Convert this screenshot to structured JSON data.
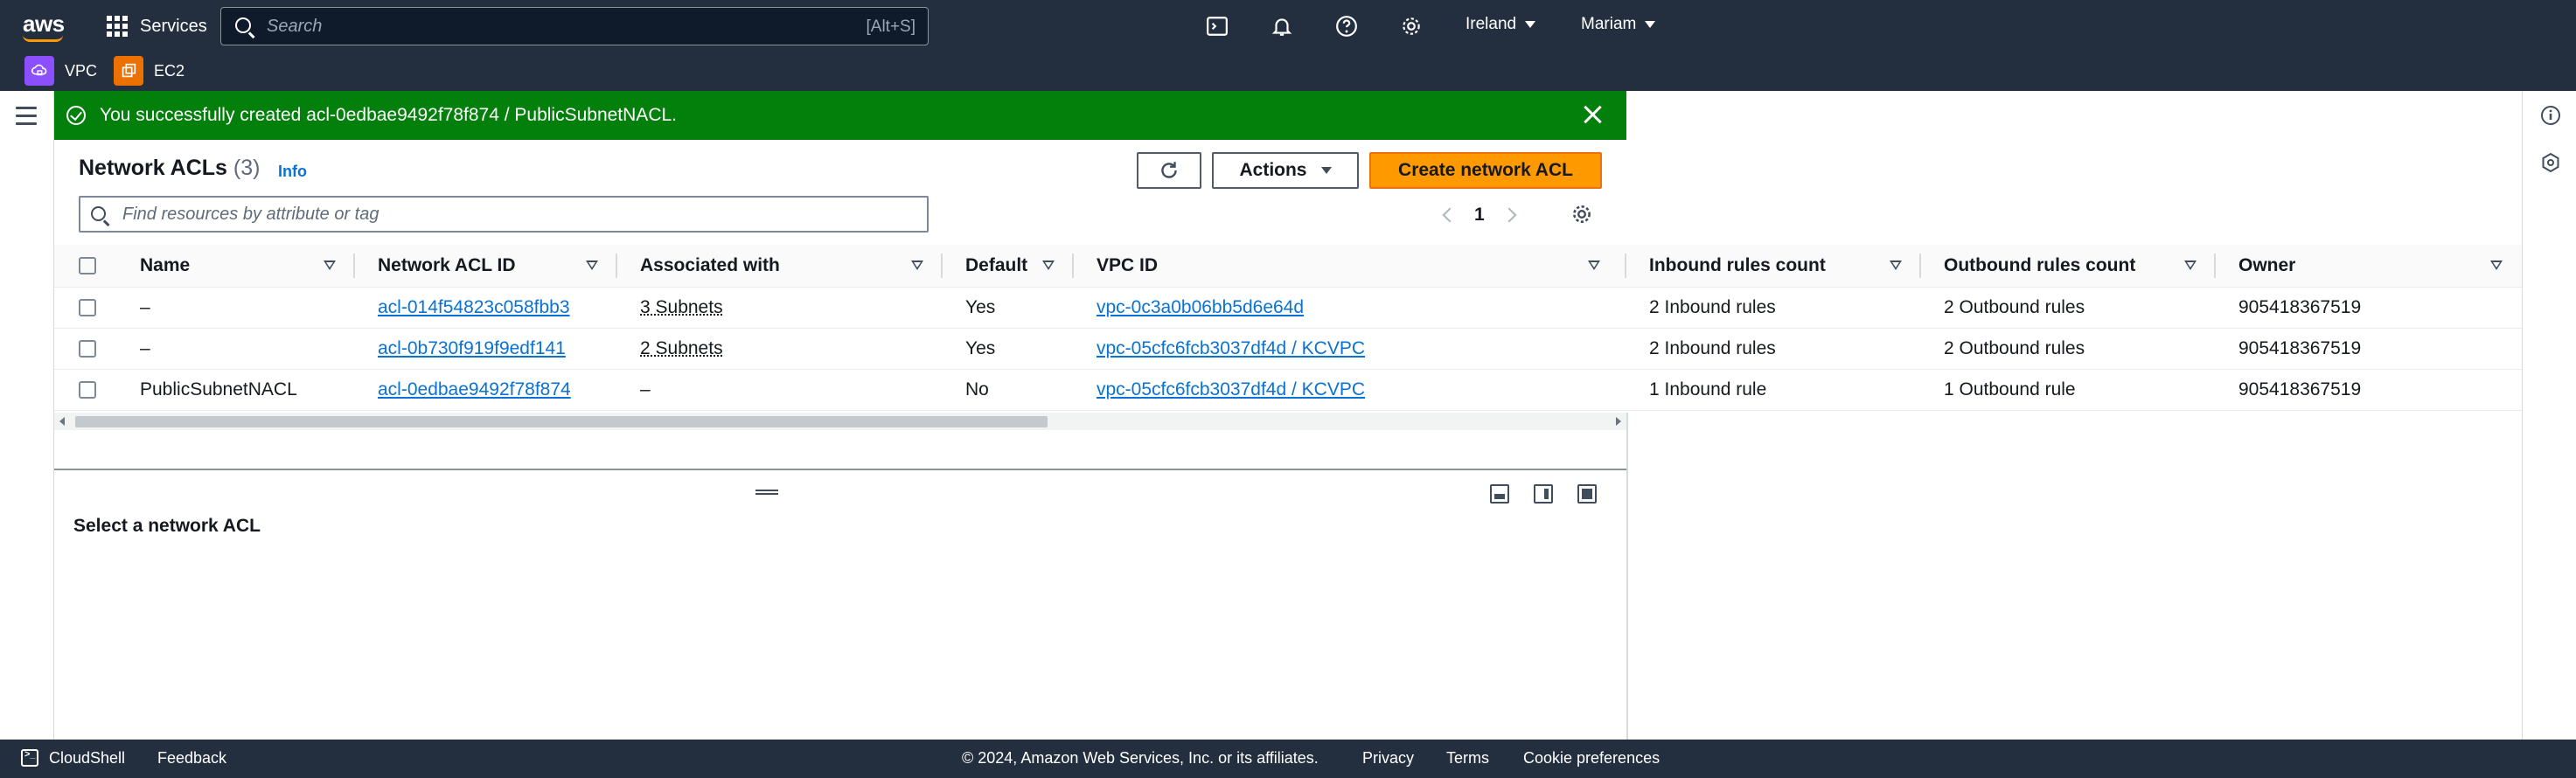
{
  "topbar": {
    "logo": "aws",
    "services_label": "Services",
    "search_placeholder": "Search",
    "search_shortcut": "[Alt+S]",
    "region": "Ireland",
    "user": "Mariam"
  },
  "favorites": [
    {
      "label": "VPC",
      "color": "#8c4fff"
    },
    {
      "label": "EC2",
      "color": "#ed7100"
    }
  ],
  "flash": {
    "message": "You successfully created acl-0edbae9492f78f874 / PublicSubnetNACL."
  },
  "header": {
    "title": "Network ACLs",
    "count": "(3)",
    "info": "Info",
    "actions_label": "Actions",
    "create_label": "Create network ACL",
    "filter_placeholder": "Find resources by attribute or tag",
    "page": "1"
  },
  "columns": [
    "Name",
    "Network ACL ID",
    "Associated with",
    "Default",
    "VPC ID",
    "Inbound rules count",
    "Outbound rules count",
    "Owner"
  ],
  "rows": [
    {
      "name": "–",
      "acl_id": "acl-014f54823c058fbb3",
      "associated": "3 Subnets",
      "default": "Yes",
      "vpc_id": "vpc-0c3a0b06bb5d6e64d",
      "inbound": "2 Inbound rules",
      "outbound": "2 Outbound rules",
      "owner": "905418367519"
    },
    {
      "name": "–",
      "acl_id": "acl-0b730f919f9edf141",
      "associated": "2 Subnets",
      "default": "Yes",
      "vpc_id": "vpc-05cfc6fcb3037df4d / KCVPC",
      "inbound": "2 Inbound rules",
      "outbound": "2 Outbound rules",
      "owner": "905418367519"
    },
    {
      "name": "PublicSubnetNACL",
      "acl_id": "acl-0edbae9492f78f874",
      "associated": "–",
      "default": "No",
      "vpc_id": "vpc-05cfc6fcb3037df4d / KCVPC",
      "inbound": "1 Inbound rule",
      "outbound": "1 Outbound rule",
      "owner": "905418367519"
    }
  ],
  "details": {
    "title": "Select a network ACL"
  },
  "footer": {
    "cloudshell": "CloudShell",
    "feedback": "Feedback",
    "copyright": "© 2024, Amazon Web Services, Inc. or its affiliates.",
    "privacy": "Privacy",
    "terms": "Terms",
    "cookies": "Cookie preferences"
  },
  "colors": {
    "nav_bg": "#232f3e",
    "success": "#037f0c",
    "primary": "#ff9900",
    "link": "#0972d3"
  }
}
